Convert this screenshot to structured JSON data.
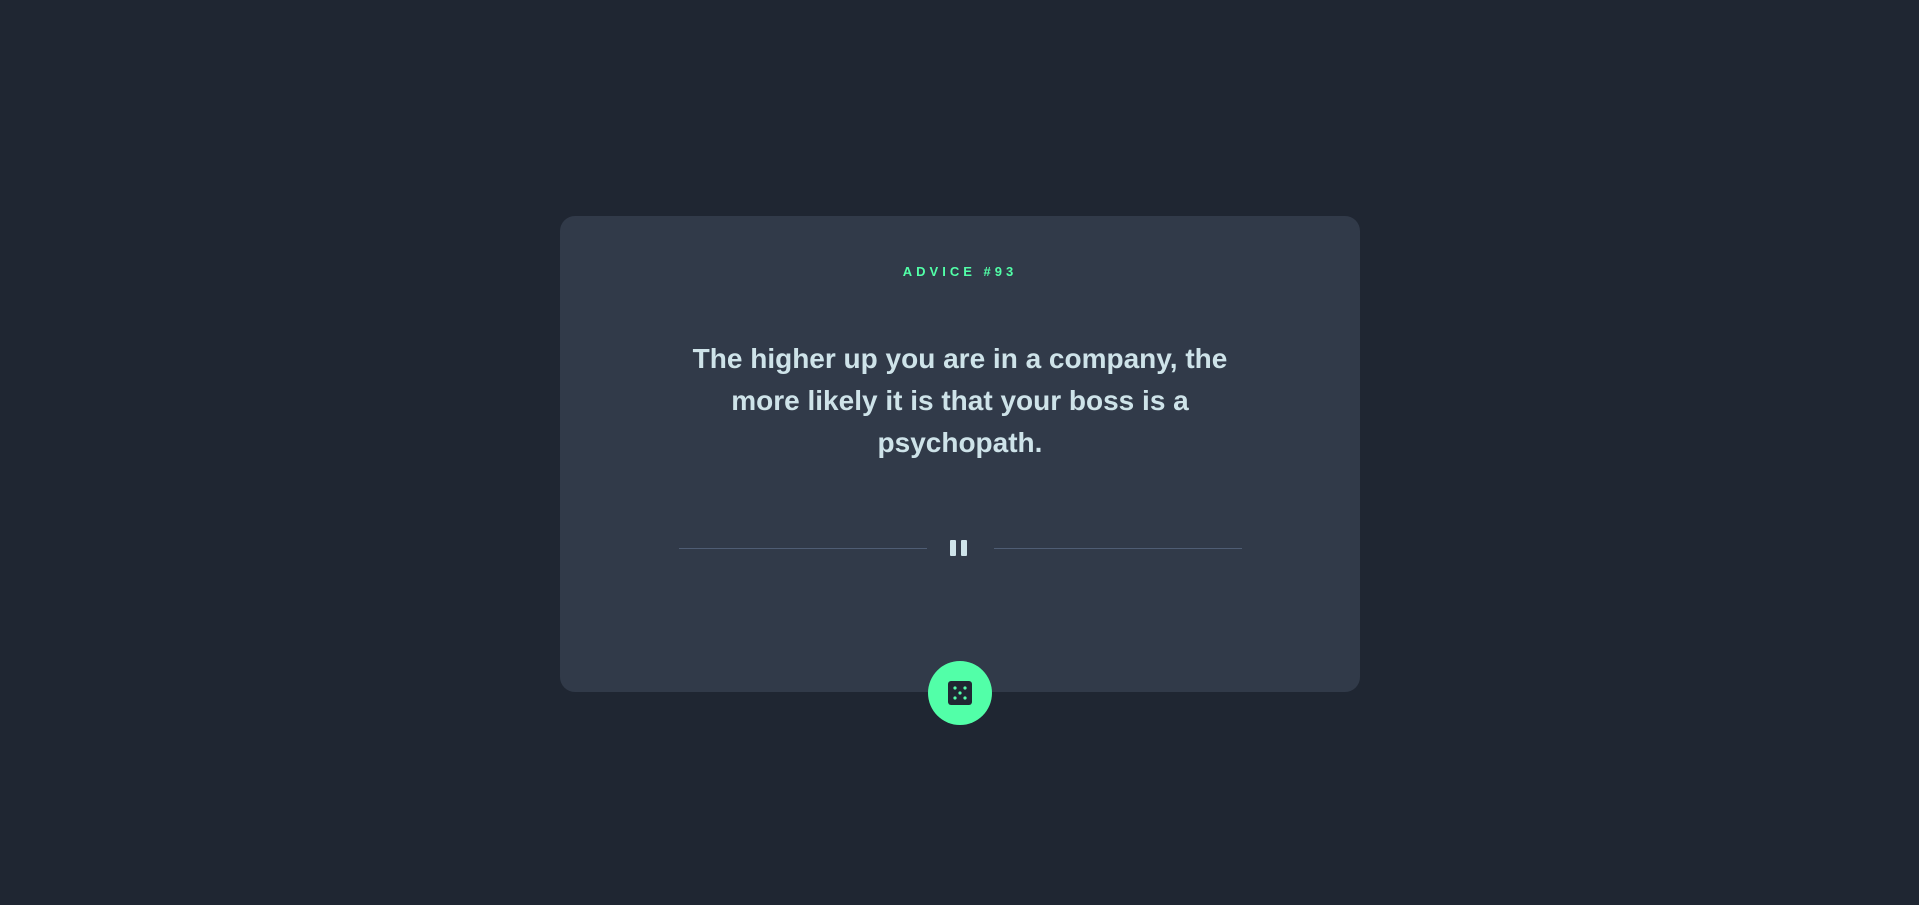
{
  "card": {
    "advice_label": "ADVICE #93",
    "advice_text": "The higher up you are in a company, the more likely it is that your boss is a psychopath."
  },
  "divider": {
    "icon": "pause-icon"
  },
  "button": {
    "icon": "dice-icon"
  },
  "colors": {
    "background": "#1f2632",
    "card": "#313a49",
    "accent": "#52ffa8",
    "text": "#cee3e9",
    "divider": "#4f5d74"
  }
}
